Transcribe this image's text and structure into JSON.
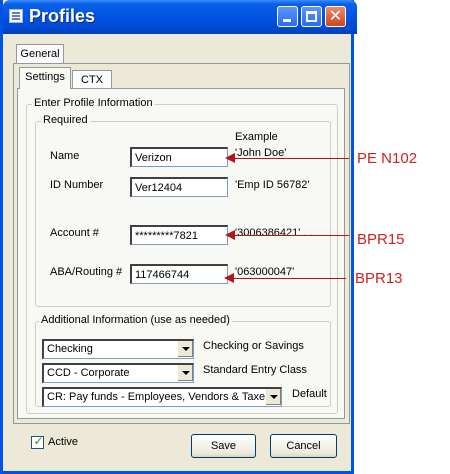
{
  "window": {
    "title": "Profiles"
  },
  "tabs": {
    "outer": [
      "General"
    ],
    "inner": [
      "Settings",
      "CTX"
    ]
  },
  "groups": {
    "enter_profile": "Enter Profile Information",
    "required": "Required",
    "additional": "Additional Information (use as needed)"
  },
  "fields": {
    "example_header": "Example",
    "name": {
      "label": "Name",
      "value": "Verizon",
      "example": "'John Doe'"
    },
    "id_number": {
      "label": "ID Number",
      "value": "Ver12404",
      "example": "'Emp ID 56782'"
    },
    "account": {
      "label": "Account #",
      "value": "*********7821",
      "example": "'3006386421' . ."
    },
    "aba": {
      "label": "ABA/Routing #",
      "value": "117466744",
      "example": "'063000047'"
    }
  },
  "additional": {
    "account_type": {
      "value": "Checking",
      "label": "Checking or Savings"
    },
    "entry_class": {
      "value": "CCD - Corporate",
      "label": "Standard Entry Class"
    },
    "default": {
      "value": "CR: Pay funds - Employees, Vendors & Taxes",
      "label": "Default"
    }
  },
  "footer": {
    "active_label": "Active",
    "active_checked": true,
    "save_label": "Save",
    "cancel_label": "Cancel"
  },
  "annotations": {
    "name": "PE N102",
    "account": "BPR15",
    "aba": "BPR13"
  },
  "colors": {
    "titlebar": "#0054e3",
    "annotation_text": "#cc2222",
    "annotation_arrow": "#b5161b",
    "dialog_face": "#ece9d8"
  }
}
